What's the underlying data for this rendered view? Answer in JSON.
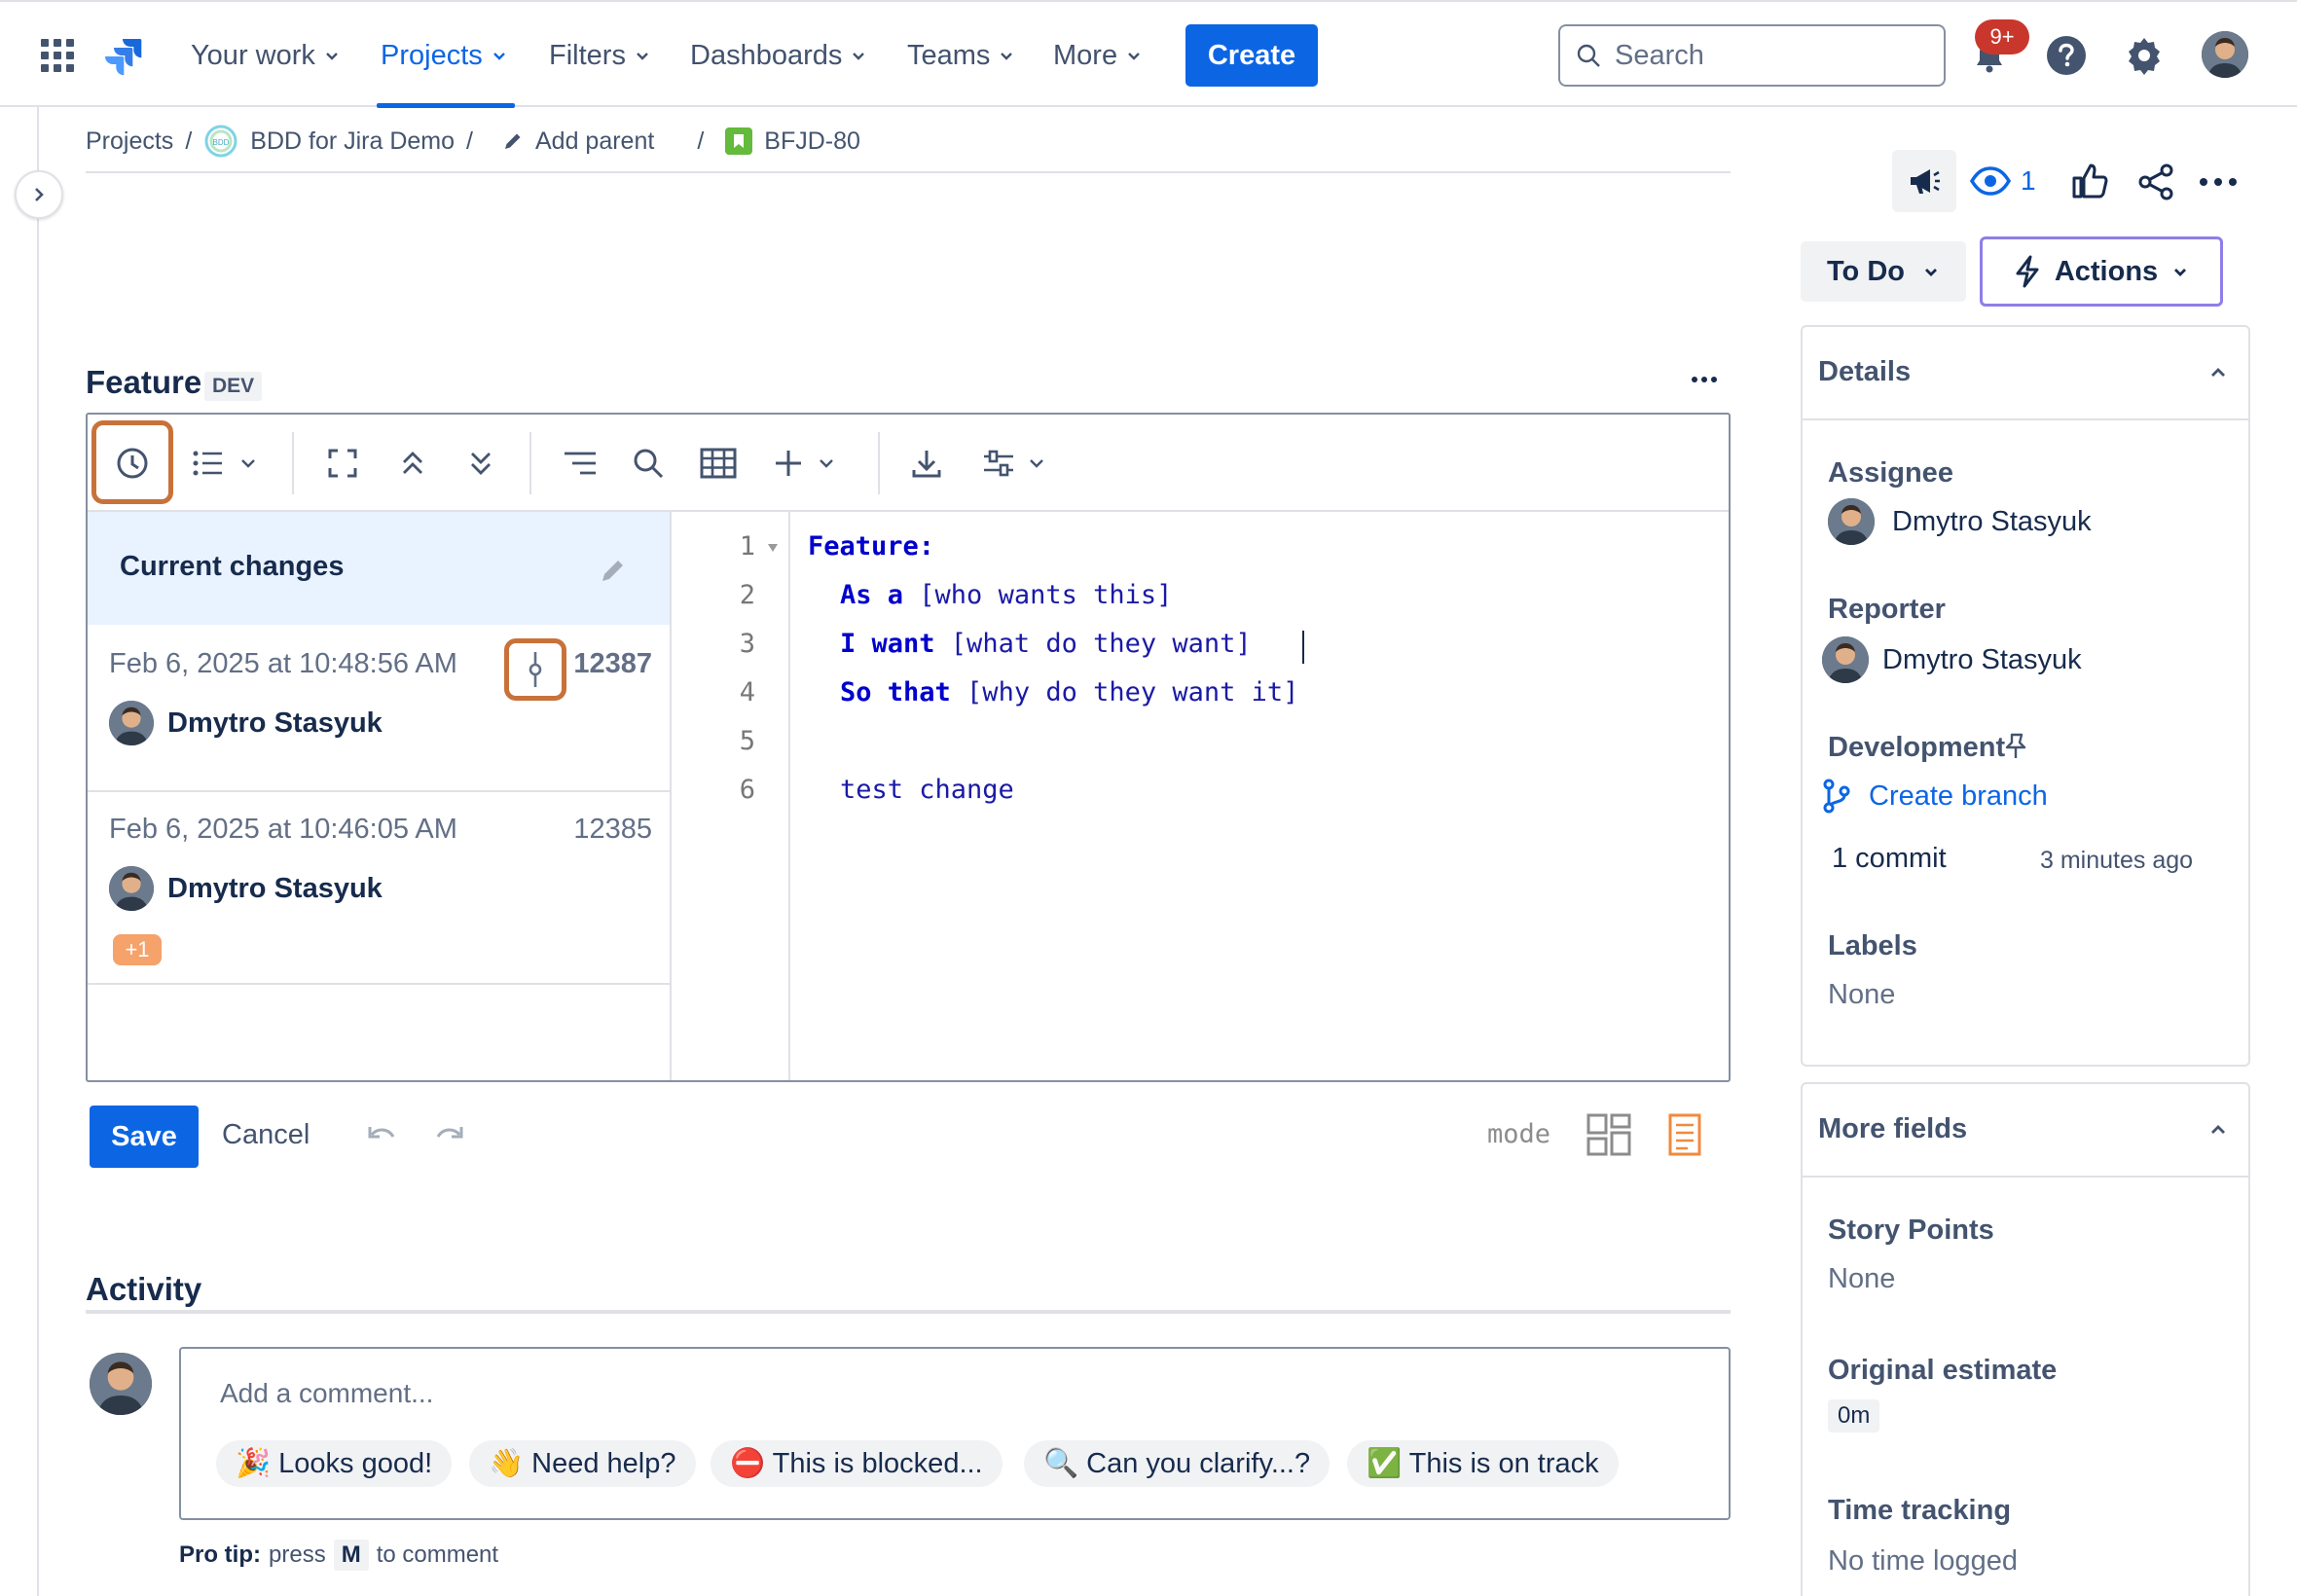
{
  "nav": {
    "items": [
      {
        "label": "Your work"
      },
      {
        "label": "Projects"
      },
      {
        "label": "Filters"
      },
      {
        "label": "Dashboards"
      },
      {
        "label": "Teams"
      },
      {
        "label": "More"
      }
    ],
    "create_label": "Create",
    "search_placeholder": "Search",
    "notifications_badge": "9+"
  },
  "breadcrumb": {
    "projects": "Projects",
    "project": "BDD for Jira Demo",
    "project_icon_text": "BDD",
    "add_parent": "Add parent",
    "issue_key": "BFJD-80"
  },
  "issue_actions": {
    "watchers_count": "1",
    "status_label": "To Do",
    "actions_label": "Actions"
  },
  "feature": {
    "title": "Feature",
    "lozenge": "DEV",
    "history": {
      "current_changes": "Current changes",
      "items": [
        {
          "date": "Feb 6, 2025 at 10:48:56 AM",
          "revision": "12387",
          "user": "Dmytro Stasyuk"
        },
        {
          "date": "Feb 6, 2025 at 10:46:05 AM",
          "revision": "12385",
          "user": "Dmytro Stasyuk",
          "extra_badge": "+1"
        }
      ]
    },
    "code": {
      "line_numbers": [
        "1",
        "2",
        "3",
        "4",
        "5",
        "6"
      ],
      "lines": [
        {
          "kw": "Feature:",
          "rest": ""
        },
        {
          "kw": "As a",
          "rest": " [who wants this]"
        },
        {
          "kw": "I want",
          "rest": " [what do they want]"
        },
        {
          "kw": "So that",
          "rest": " [why do they want it]"
        },
        {
          "kw": "",
          "rest": ""
        },
        {
          "kw": "",
          "rest": "test change"
        }
      ]
    },
    "save_label": "Save",
    "cancel_label": "Cancel",
    "mode_label": "mode"
  },
  "activity": {
    "title": "Activity",
    "comment_placeholder": "Add a comment...",
    "quick_replies": [
      {
        "label": "🎉 Looks good!"
      },
      {
        "label": "👋 Need help?"
      },
      {
        "label": "⛔ This is blocked..."
      },
      {
        "label": "🔍 Can you clarify...?"
      },
      {
        "label": "✅ This is on track"
      }
    ],
    "protip_bold": "Pro tip:",
    "protip_press": "press",
    "protip_key": "M",
    "protip_rest": "to comment"
  },
  "details": {
    "title": "Details",
    "assignee_label": "Assignee",
    "assignee": "Dmytro Stasyuk",
    "reporter_label": "Reporter",
    "reporter": "Dmytro Stasyuk",
    "development_label": "Development",
    "create_branch": "Create branch",
    "commit_count": "1 commit",
    "commit_time": "3 minutes ago",
    "labels_label": "Labels",
    "labels_value": "None"
  },
  "more_fields": {
    "title": "More fields",
    "story_points_label": "Story Points",
    "story_points_value": "None",
    "original_estimate_label": "Original estimate",
    "original_estimate_value": "0m",
    "time_tracking_label": "Time tracking",
    "time_tracking_value": "No time logged"
  },
  "colors": {
    "brand_blue": "#0c66e4",
    "highlight_orange": "#c8723a",
    "actions_border": "#8f7ee7",
    "current_changes_bg": "#e9f2ff"
  }
}
